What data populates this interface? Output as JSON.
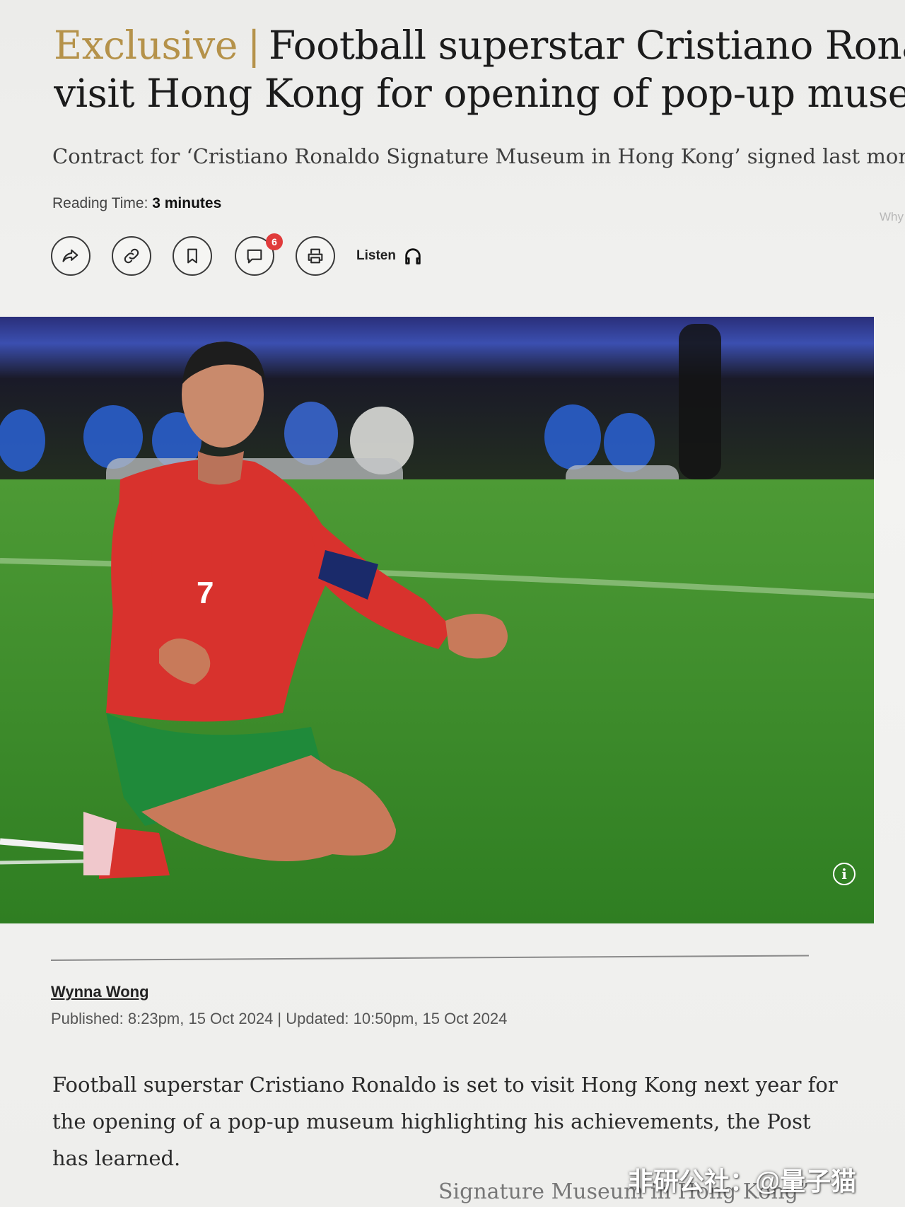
{
  "article": {
    "tag": "Exclusive",
    "separator": "|",
    "title_line1": "Football superstar Cristiano Ronaldo",
    "title_line2": "visit Hong Kong for opening of pop-up museum",
    "subhead": "Contract for ‘Cristiano Ronaldo Signature Museum in Hong Kong’ signed last month",
    "reading_label": "Reading Time:",
    "reading_value": "3 minutes",
    "why_text": "Why"
  },
  "toolbar": {
    "comment_count": "6",
    "listen_label": "Listen"
  },
  "byline": {
    "author": "Wynna Wong",
    "dates": "Published: 8:23pm, 15 Oct 2024 | Updated: 10:50pm, 15 Oct 2024"
  },
  "body": {
    "paragraph1": "Football superstar Cristiano Ronaldo is set to visit Hong Kong next year for the opening of a pop-up museum highlighting his achievements, the Post has learned.",
    "partial_line": "Signature Museum in Hong Kong”"
  },
  "photo": {
    "jersey_number": "7",
    "info_glyph": "i"
  },
  "watermark": "非研公社：@量子猫",
  "colors": {
    "tag_gold": "#b5924a",
    "badge_red": "#e03b3b",
    "jersey_red": "#d8322d",
    "shorts_green": "#1f8a3a",
    "pitch_green": "#3f8d2e"
  },
  "icons": [
    "share-icon",
    "link-icon",
    "bookmark-icon",
    "comment-icon",
    "print-icon",
    "headphones-icon",
    "info-icon"
  ]
}
